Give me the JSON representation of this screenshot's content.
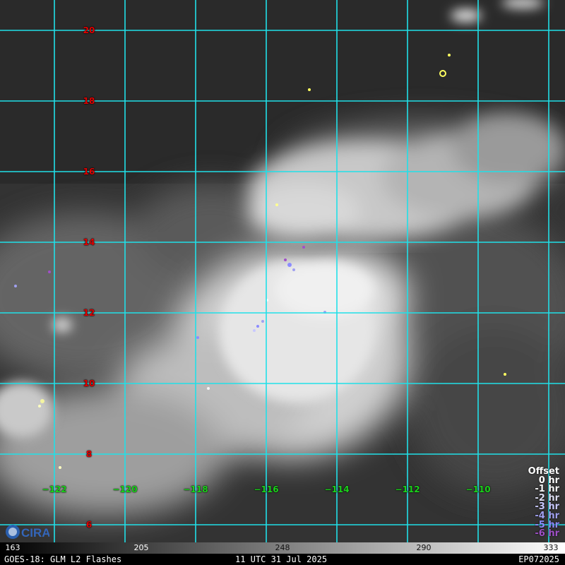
{
  "map": {
    "lat_labels": [
      "20",
      "18",
      "16",
      "14",
      "12",
      "10",
      "8",
      "6"
    ],
    "lon_labels": [
      "−122",
      "−120",
      "−118",
      "−116",
      "−114",
      "−112",
      "−110"
    ],
    "grid_color": "#20e0e8",
    "lat_label_color": "#e00000",
    "lon_label_color": "#1bd21b"
  },
  "legend": {
    "title": "Offset",
    "items": [
      {
        "label": "0 hr",
        "color": "#ffffff"
      },
      {
        "label": "-1 hr",
        "color": "#f4f4f4"
      },
      {
        "label": "-2 hr",
        "color": "#dcdcf0"
      },
      {
        "label": "-3 hr",
        "color": "#c8c8ff"
      },
      {
        "label": "-4 hr",
        "color": "#a0a0f0"
      },
      {
        "label": "-5 hr",
        "color": "#8c8cff"
      },
      {
        "label": "-6 hr",
        "color": "#a050c8"
      }
    ]
  },
  "colorbar": {
    "ticks": [
      "163",
      "205",
      "248",
      "290",
      "333"
    ]
  },
  "footer": {
    "left": "GOES-18: GLM L2 Flashes",
    "center": "11 UTC 31 Jul 2025",
    "right": "EP072025"
  },
  "logo": {
    "text": "CIRA"
  }
}
